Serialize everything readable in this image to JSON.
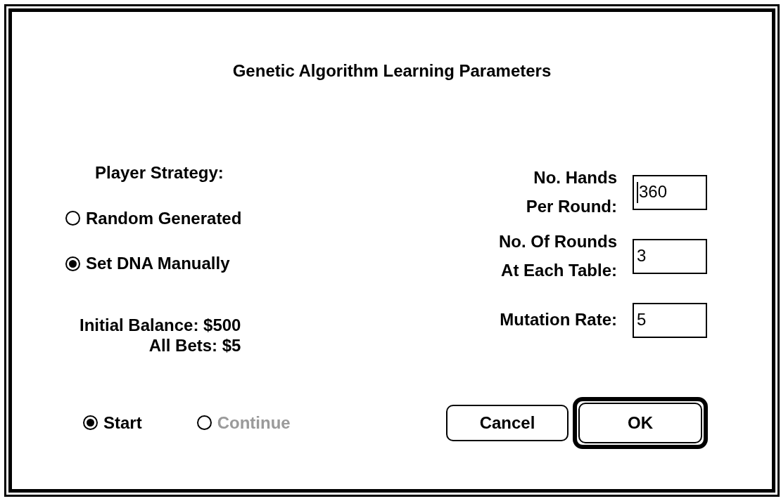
{
  "dialog": {
    "title": "Genetic Algorithm Learning Parameters"
  },
  "strategy": {
    "label": "Player Strategy:",
    "options": [
      {
        "label": "Random Generated",
        "selected": false
      },
      {
        "label": "Set DNA Manually",
        "selected": true
      }
    ]
  },
  "info": [
    "Initial Balance: $500",
    "All Bets: $5"
  ],
  "parameters": [
    {
      "label": "No. Hands\nPer Round:",
      "value": "360",
      "focused": true
    },
    {
      "label": "No. Of Rounds\nAt Each Table:",
      "value": "3",
      "focused": false
    },
    {
      "label": "Mutation Rate:",
      "value": "5",
      "focused": false
    }
  ],
  "mode": [
    {
      "label": "Start",
      "selected": true,
      "disabled": false
    },
    {
      "label": "Continue",
      "selected": false,
      "disabled": true
    }
  ],
  "buttons": [
    {
      "label": "Cancel",
      "default": false
    },
    {
      "label": "OK",
      "default": true
    }
  ]
}
